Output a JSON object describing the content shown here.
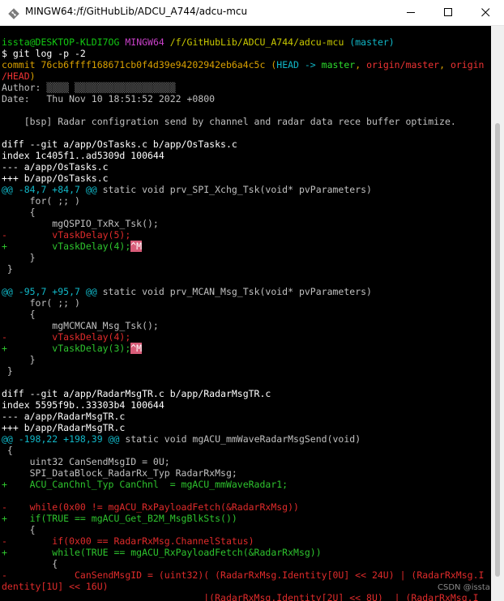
{
  "window": {
    "title": "MINGW64:/f/GitHubLib/ADCU_A744/adcu-mcu",
    "icon": "git-bash-icon",
    "controls": [
      "minimize-icon",
      "maximize-icon",
      "close-icon"
    ]
  },
  "colors": {
    "prompt_user": "#13c913",
    "prompt_env": "#c840c8",
    "prompt_path": "#c8c800",
    "branch": "#11b7c7",
    "hunk": "#11b7c7",
    "added": "#2ec42e",
    "removed": "#e02b2b",
    "crlf_marker": "#d85c78"
  },
  "terminal": {
    "lines": [
      {
        "segments": [
          {
            "t": "issta@DESKTOP-KLDI7OG",
            "c": "c-green"
          },
          {
            "t": " ",
            "c": "c-gray"
          },
          {
            "t": "MINGW64",
            "c": "c-magenta"
          },
          {
            "t": " ",
            "c": "c-gray"
          },
          {
            "t": "/f/GitHubLib/ADCU_A744/adcu-mcu",
            "c": "c-yellow"
          },
          {
            "t": " ",
            "c": "c-gray"
          },
          {
            "t": "(master)",
            "c": "c-cyan"
          }
        ]
      },
      {
        "segments": [
          {
            "t": "$ git log -p -2",
            "c": "c-white"
          }
        ]
      },
      {
        "segments": [
          {
            "t": "commit 76cb6ffff168671cb0f4d39e94202942eb6a4c5c (",
            "c": "c-orange"
          },
          {
            "t": "HEAD -> ",
            "c": "c-cyan"
          },
          {
            "t": "master",
            "c": "c-bgreen"
          },
          {
            "t": ", ",
            "c": "c-orange"
          },
          {
            "t": "origin/master",
            "c": "c-red"
          },
          {
            "t": ", ",
            "c": "c-orange"
          },
          {
            "t": "origin",
            "c": "c-red"
          }
        ]
      },
      {
        "segments": [
          {
            "t": "/HEAD",
            "c": "c-red"
          },
          {
            "t": ")",
            "c": "c-orange"
          }
        ]
      },
      {
        "segments": [
          {
            "t": "Author: ",
            "c": "c-gray"
          },
          {
            "t": "▒▒▒▒ ▒▒▒▒▒▒▒▒▒▒▒▒▒▒▒▒▒▒",
            "c": "redacted"
          }
        ]
      },
      {
        "segments": [
          {
            "t": "Date:   Thu Nov 10 18:51:52 2022 +0800",
            "c": "c-gray"
          }
        ]
      },
      {
        "segments": [
          {
            "t": "",
            "c": "c-gray"
          }
        ]
      },
      {
        "segments": [
          {
            "t": "    [bsp] Radar configration send by channel and radar data rece buffer optimize.",
            "c": "c-gray"
          }
        ]
      },
      {
        "segments": [
          {
            "t": "",
            "c": "c-gray"
          }
        ]
      },
      {
        "segments": [
          {
            "t": "diff --git a/app/OsTasks.c b/app/OsTasks.c",
            "c": "c-white"
          }
        ]
      },
      {
        "segments": [
          {
            "t": "index 1c405f1..ad5309d 100644",
            "c": "c-white"
          }
        ]
      },
      {
        "segments": [
          {
            "t": "--- a/app/OsTasks.c",
            "c": "c-white"
          }
        ]
      },
      {
        "segments": [
          {
            "t": "+++ b/app/OsTasks.c",
            "c": "c-white"
          }
        ]
      },
      {
        "segments": [
          {
            "t": "@@ -84,7 +84,7 @@",
            "c": "c-hunk"
          },
          {
            "t": " static void prv_SPI_Xchg_Tsk(void* pvParameters)",
            "c": "c-gray"
          }
        ]
      },
      {
        "segments": [
          {
            "t": "     for( ;; )",
            "c": "c-gray"
          }
        ]
      },
      {
        "segments": [
          {
            "t": "     {",
            "c": "c-gray"
          }
        ]
      },
      {
        "segments": [
          {
            "t": "         mgQSPIO_TxRx_Tsk();",
            "c": "c-gray"
          }
        ]
      },
      {
        "segments": [
          {
            "t": "-        vTaskDelay(5);",
            "c": "c-del"
          }
        ]
      },
      {
        "segments": [
          {
            "t": "+        vTaskDelay(4);",
            "c": "c-add"
          },
          {
            "t": "^M",
            "c": "crlf"
          }
        ]
      },
      {
        "segments": [
          {
            "t": "     }",
            "c": "c-gray"
          }
        ]
      },
      {
        "segments": [
          {
            "t": " }",
            "c": "c-gray"
          }
        ]
      },
      {
        "segments": [
          {
            "t": "",
            "c": "c-gray"
          }
        ]
      },
      {
        "segments": [
          {
            "t": "@@ -95,7 +95,7 @@",
            "c": "c-hunk"
          },
          {
            "t": " static void prv_MCAN_Msg_Tsk(void* pvParameters)",
            "c": "c-gray"
          }
        ]
      },
      {
        "segments": [
          {
            "t": "     for( ;; )",
            "c": "c-gray"
          }
        ]
      },
      {
        "segments": [
          {
            "t": "     {",
            "c": "c-gray"
          }
        ]
      },
      {
        "segments": [
          {
            "t": "         mgMCMCAN_Msg_Tsk();",
            "c": "c-gray"
          }
        ]
      },
      {
        "segments": [
          {
            "t": "-        vTaskDelay(4);",
            "c": "c-del"
          }
        ]
      },
      {
        "segments": [
          {
            "t": "+        vTaskDelay(3);",
            "c": "c-add"
          },
          {
            "t": "^M",
            "c": "crlf"
          }
        ]
      },
      {
        "segments": [
          {
            "t": "     }",
            "c": "c-gray"
          }
        ]
      },
      {
        "segments": [
          {
            "t": " }",
            "c": "c-gray"
          }
        ]
      },
      {
        "segments": [
          {
            "t": "",
            "c": "c-gray"
          }
        ]
      },
      {
        "segments": [
          {
            "t": "diff --git a/app/RadarMsgTR.c b/app/RadarMsgTR.c",
            "c": "c-white"
          }
        ]
      },
      {
        "segments": [
          {
            "t": "index 5595f9b..33303b4 100644",
            "c": "c-white"
          }
        ]
      },
      {
        "segments": [
          {
            "t": "--- a/app/RadarMsgTR.c",
            "c": "c-white"
          }
        ]
      },
      {
        "segments": [
          {
            "t": "+++ b/app/RadarMsgTR.c",
            "c": "c-white"
          }
        ]
      },
      {
        "segments": [
          {
            "t": "@@ -198,22 +198,39 @@",
            "c": "c-hunk"
          },
          {
            "t": " static void mgACU_mmWaveRadarMsgSend(void)",
            "c": "c-gray"
          }
        ]
      },
      {
        "segments": [
          {
            "t": " {",
            "c": "c-gray"
          }
        ]
      },
      {
        "segments": [
          {
            "t": "     uint32 CanSendMsgID = 0U;",
            "c": "c-gray"
          }
        ]
      },
      {
        "segments": [
          {
            "t": "     SPI_DataBlock_RadarRx_Typ RadarRxMsg;",
            "c": "c-gray"
          }
        ]
      },
      {
        "segments": [
          {
            "t": "+    ACU_CanChnl_Typ CanChnl  = mgACU_mmWaveRadar1;",
            "c": "c-add"
          }
        ]
      },
      {
        "segments": [
          {
            "t": "",
            "c": "c-gray"
          }
        ]
      },
      {
        "segments": [
          {
            "t": "-    while(0x00 != mgACU_RxPayloadFetch(&RadarRxMsg))",
            "c": "c-del"
          }
        ]
      },
      {
        "segments": [
          {
            "t": "+    if(TRUE == mgACU_Get_B2M_MsgBlkSts())",
            "c": "c-add"
          }
        ]
      },
      {
        "segments": [
          {
            "t": "     {",
            "c": "c-gray"
          }
        ]
      },
      {
        "segments": [
          {
            "t": "-        if(0x00 == RadarRxMsg.ChannelStatus)",
            "c": "c-del"
          }
        ]
      },
      {
        "segments": [
          {
            "t": "+        while(TRUE == mgACU_RxPayloadFetch(&RadarRxMsg))",
            "c": "c-add"
          }
        ]
      },
      {
        "segments": [
          {
            "t": "         {",
            "c": "c-gray"
          }
        ]
      },
      {
        "segments": [
          {
            "t": "-            CanSendMsgID = (uint32)( (RadarRxMsg.Identity[0U] << 24U) | (RadarRxMsg.I",
            "c": "c-del"
          }
        ]
      },
      {
        "segments": [
          {
            "t": "dentity[1U] << 16U)",
            "c": "c-del"
          }
        ]
      },
      {
        "segments": [
          {
            "t": "                                    |(RadarRxMsg.Identity[2U] << 8U)  | (RadarRxMsg.I",
            "c": "c-del"
          }
        ]
      }
    ]
  },
  "watermark": "CSDN @issta"
}
